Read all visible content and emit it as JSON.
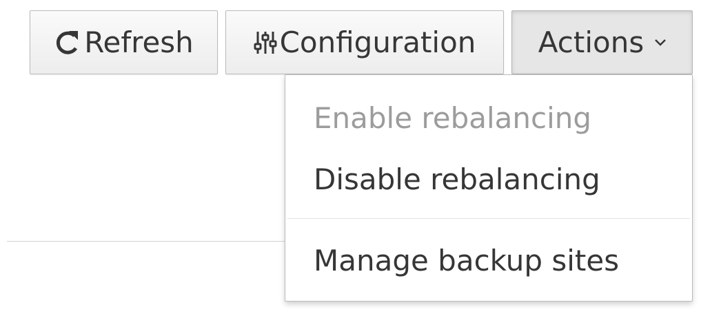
{
  "toolbar": {
    "refresh": {
      "label": "Refresh",
      "icon": "refresh-icon"
    },
    "configuration": {
      "label": "Configuration",
      "icon": "sliders-icon"
    },
    "actions": {
      "label": "Actions",
      "icon": "chevron-down-icon",
      "expanded": true
    }
  },
  "actions_menu": {
    "items": [
      {
        "label": "Enable rebalancing",
        "disabled": true
      },
      {
        "label": "Disable rebalancing",
        "disabled": false
      },
      {
        "label": "Manage backup sites",
        "disabled": false
      }
    ]
  },
  "colors": {
    "text": "#363636",
    "disabled_text": "#9c9c9c",
    "button_border": "#bbbbbb",
    "active_button_bg": "#e6e6e6"
  }
}
